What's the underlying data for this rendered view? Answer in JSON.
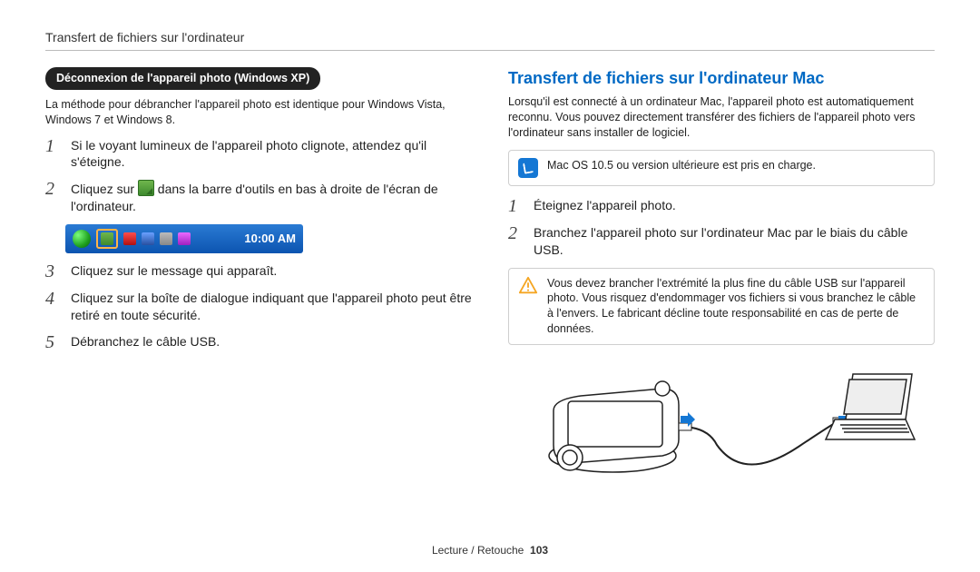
{
  "running_head": "Transfert de fichiers sur l'ordinateur",
  "left": {
    "pill": "Déconnexion de l'appareil photo (Windows XP)",
    "intro": "La méthode pour débrancher l'appareil photo est identique pour Windows Vista, Windows 7 et Windows 8.",
    "steps": [
      "Si le voyant lumineux de l'appareil photo clignote, attendez qu'il s'éteigne.",
      "Cliquez sur [icon] dans la barre d'outils en bas à droite de l'écran de l'ordinateur.",
      "Cliquez sur le message qui apparaît.",
      "Cliquez sur la boîte de dialogue indiquant que l'appareil photo peut être retiré en toute sécurité.",
      "Débranchez le câble USB."
    ],
    "step2_pre": "Cliquez sur ",
    "step2_post": " dans la barre d'outils en bas à droite de l'écran de l'ordinateur.",
    "taskbar_clock": "10:00 AM"
  },
  "right": {
    "heading": "Transfert de fichiers sur l'ordinateur Mac",
    "intro": "Lorsqu'il est connecté à un ordinateur Mac, l'appareil photo est automatiquement reconnu. Vous pouvez directement transférer des fichiers de l'appareil photo vers l'ordinateur sans installer de logiciel.",
    "info_note": "Mac OS 10.5 ou version ultérieure est pris en charge.",
    "steps": [
      "Éteignez l'appareil photo.",
      "Branchez l'appareil photo sur l'ordinateur Mac par le biais du câble USB."
    ],
    "warn_note": "Vous devez brancher l'extrémité la plus fine du câble USB sur l'appareil photo. Vous risquez d'endommager vos fichiers si vous branchez le câble à l'envers. Le fabricant décline toute responsabilité en cas de perte de données."
  },
  "footer": {
    "section": "Lecture / Retouche",
    "page": "103"
  }
}
